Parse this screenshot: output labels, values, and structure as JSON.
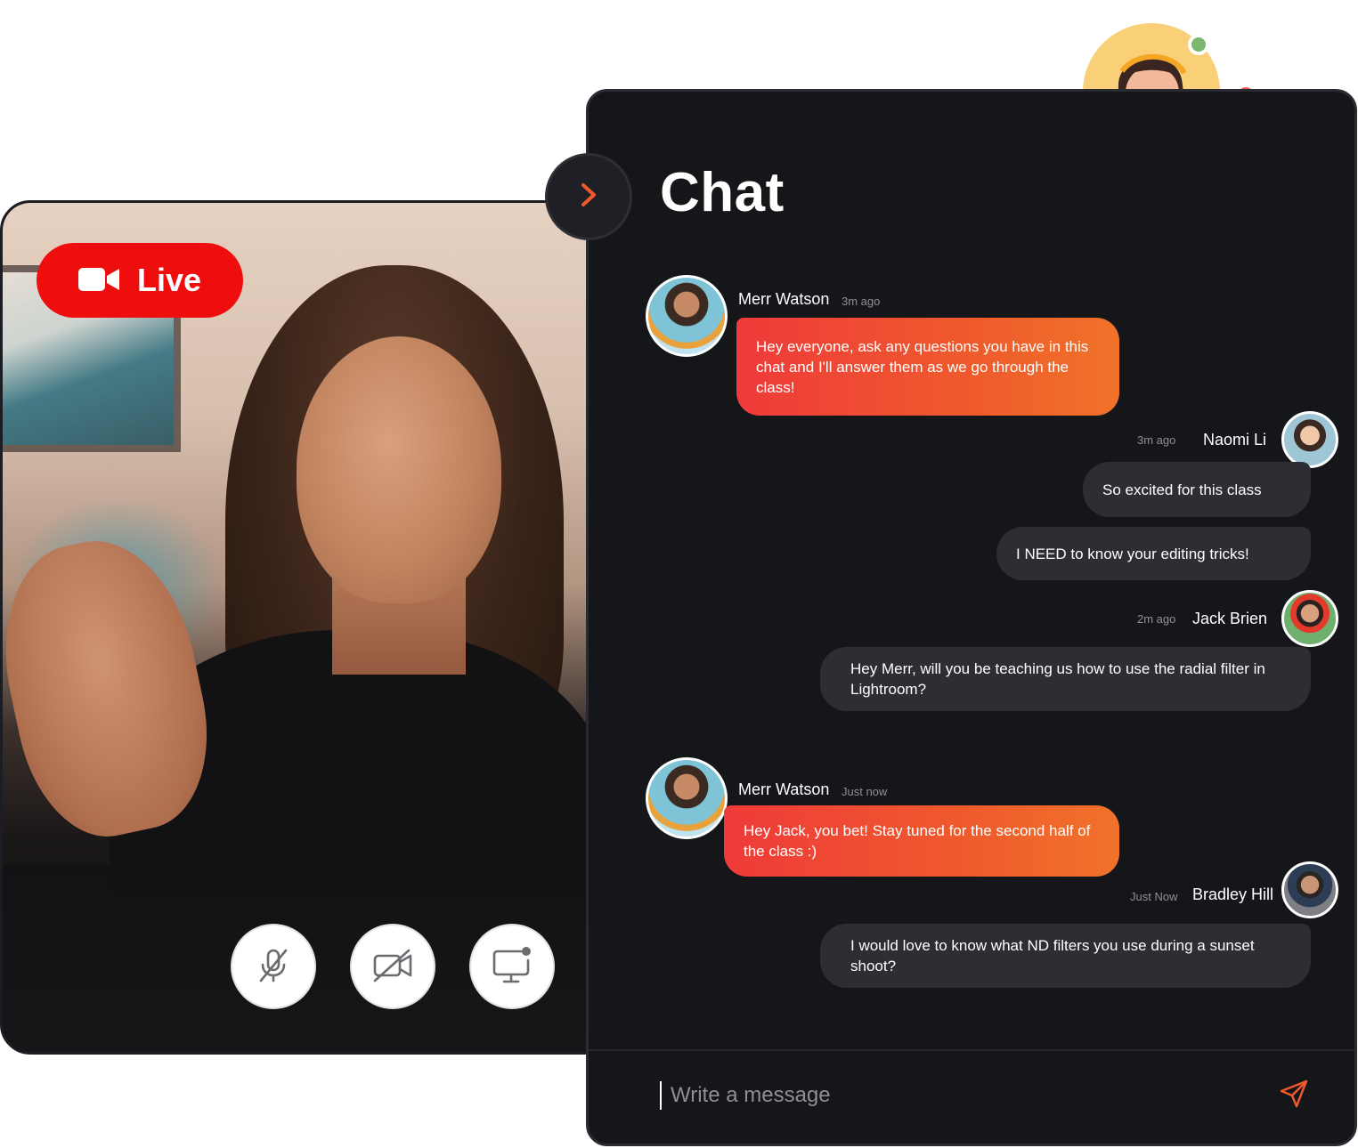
{
  "video": {
    "live_label": "Live",
    "controls": [
      {
        "name": "mute-microphone",
        "icon": "mic-off-icon"
      },
      {
        "name": "camera-off",
        "icon": "video-off-icon"
      },
      {
        "name": "share-screen",
        "icon": "screen-share-icon"
      }
    ]
  },
  "chat": {
    "title": "Chat",
    "messages": [
      {
        "sender": "Merr Watson",
        "time": "3m ago",
        "role": "host",
        "text": "Hey everyone, ask any questions you have in this chat and I'll answer them as we go through the class!"
      },
      {
        "sender": "Naomi Li",
        "time": "3m ago",
        "role": "user",
        "text": "So excited for this class"
      },
      {
        "sender": "Naomi Li",
        "time": "",
        "role": "user",
        "text": "I NEED to know your editing tricks!"
      },
      {
        "sender": "Jack Brien",
        "time": "2m ago",
        "role": "user",
        "text": "Hey Merr, will you be teaching us how to use the radial filter in Lightroom?"
      },
      {
        "sender": "Merr Watson",
        "time": "Just now",
        "role": "host",
        "text": "Hey Jack, you bet! Stay tuned for the second half of the class :)"
      },
      {
        "sender": "Bradley Hill",
        "time": "Just Now",
        "role": "user",
        "text": "I would love to know what ND filters you use during a sunset shoot?"
      }
    ],
    "composer": {
      "placeholder": "Write a message",
      "value": ""
    }
  },
  "colors": {
    "live_red": "#ef0e0e",
    "accent_orange": "#f0722a",
    "panel_bg": "#15161a",
    "user_bubble": "#2d2e33"
  }
}
